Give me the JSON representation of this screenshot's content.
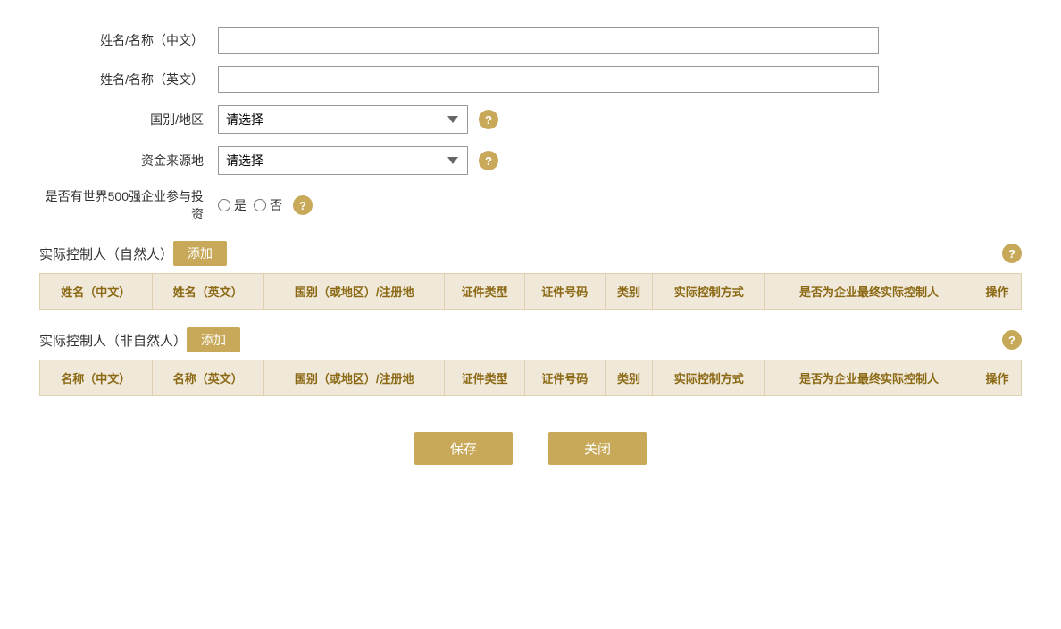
{
  "form": {
    "name_cn_label": "姓名/名称（中文）",
    "name_en_label": "姓名/名称（英文）",
    "country_label": "国别/地区",
    "fund_source_label": "资金来源地",
    "fortune500_label": "是否有世界500强企业参与投资",
    "select_placeholder": "请选择",
    "radio_yes": "是",
    "radio_no": "否"
  },
  "natural_person_section": {
    "title": "实际控制人（自然人）",
    "add_label": "添加",
    "columns": [
      "姓名（中文）",
      "姓名（英文）",
      "国别（或地区）/注册地",
      "证件类型",
      "证件号码",
      "类别",
      "实际控制方式",
      "是否为企业最终实际控制人",
      "操作"
    ]
  },
  "non_natural_person_section": {
    "title": "实际控制人（非自然人）",
    "add_label": "添加",
    "columns": [
      "名称（中文）",
      "名称（英文）",
      "国别（或地区）/注册地",
      "证件类型",
      "证件号码",
      "类别",
      "实际控制方式",
      "是否为企业最终实际控制人",
      "操作"
    ]
  },
  "buttons": {
    "save": "保存",
    "close": "关闭"
  },
  "icons": {
    "help": "?",
    "dropdown": "▼"
  }
}
